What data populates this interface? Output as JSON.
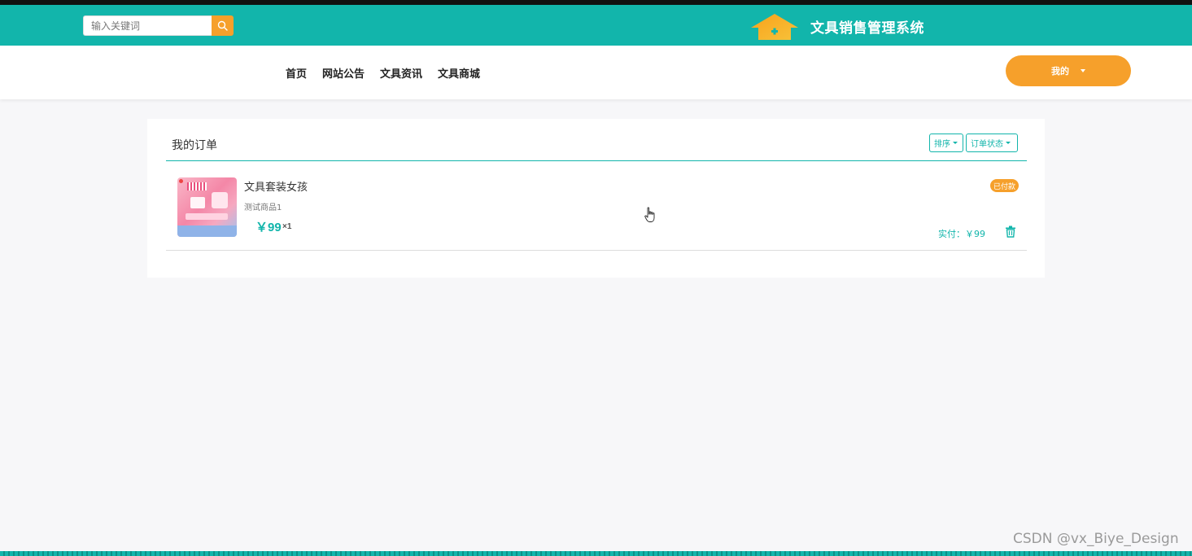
{
  "header": {
    "search_placeholder": "输入关键词",
    "app_title": "文具销售管理系统"
  },
  "nav": {
    "links": [
      "首页",
      "网站公告",
      "文具资讯",
      "文具商城"
    ],
    "my_label": "我的"
  },
  "orders_panel": {
    "title": "我的订单",
    "sort_label": "排序",
    "status_label": "订单状态",
    "orders": [
      {
        "product_name": "文具套装女孩",
        "product_sub": "测试商品1",
        "price": "￥99",
        "quantity": "×1",
        "status_badge": "已付款",
        "actual_paid": "实付：￥99"
      }
    ]
  },
  "watermark": "CSDN @vx_Biye_Design",
  "colors": {
    "primary": "#12b5ab",
    "accent": "#f6a02b",
    "background": "#f7f7f9"
  }
}
